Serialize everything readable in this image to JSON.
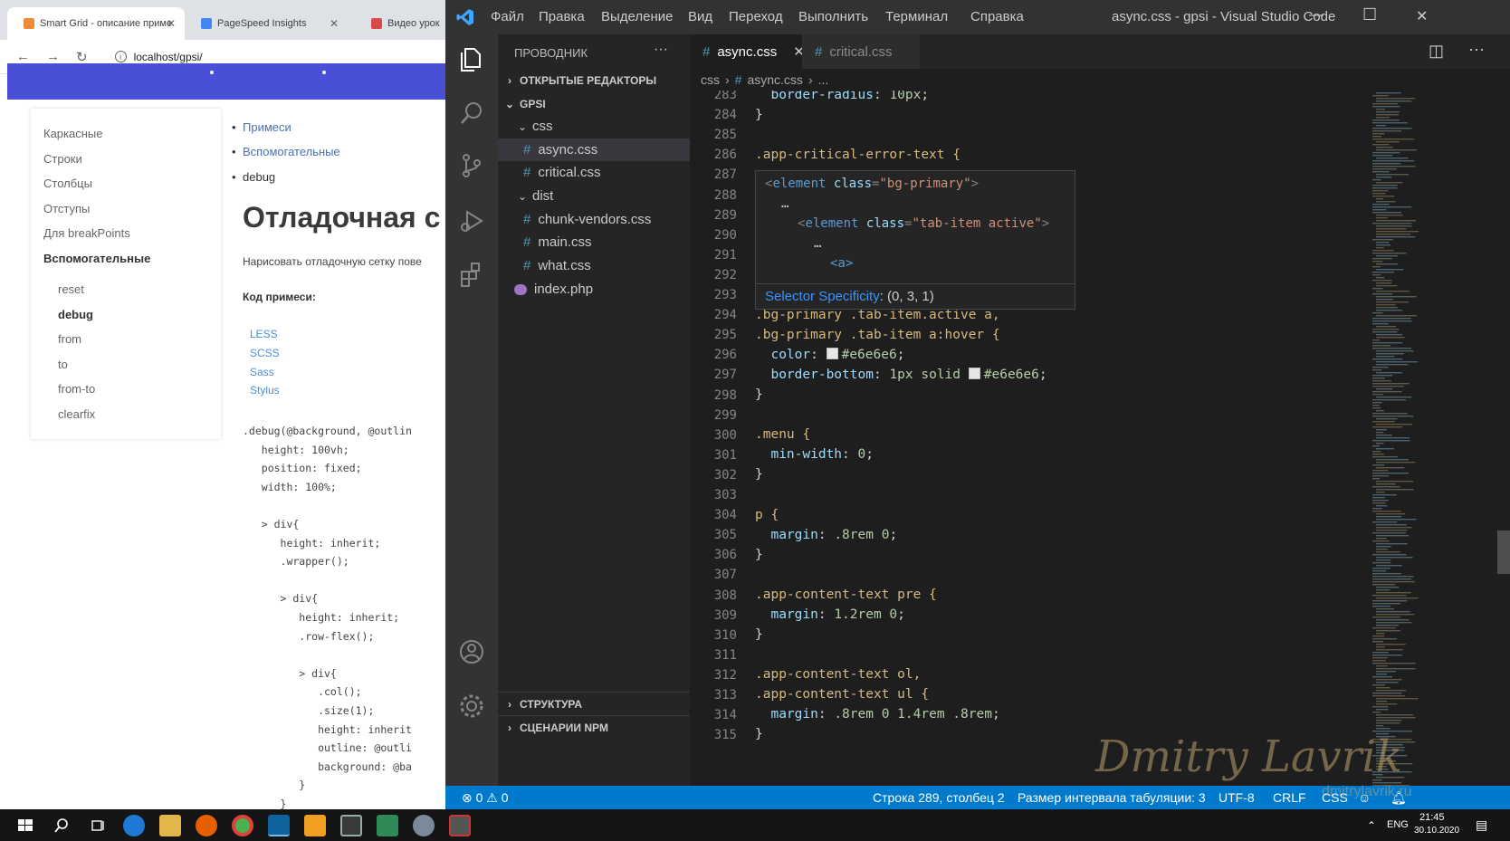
{
  "browser": {
    "tabs": [
      {
        "title": "Smart Grid - описание приме",
        "active": true
      },
      {
        "title": "PageSpeed Insights",
        "active": false
      },
      {
        "title": "Видео урок",
        "active": false
      }
    ],
    "url": "localhost/gpsi/",
    "sidebar": {
      "items": [
        "Каркасные",
        "Строки",
        "Столбцы",
        "Отступы",
        "Для breakPoints",
        "Вспомогательные"
      ],
      "subitems": [
        "reset",
        "debug",
        "from",
        "to",
        "from-to",
        "clearfix"
      ]
    },
    "content": {
      "bullets": [
        "Примеси",
        "Вспомогательные",
        "debug"
      ],
      "heading": "Отладочная с",
      "description": "Нарисовать отладочную сетку пове",
      "subheading": "Код примеси:",
      "langs": [
        "LESS",
        "SCSS",
        "Sass",
        "Stylus"
      ],
      "code": [
        ".debug(@background, @outlin",
        "   height: 100vh;",
        "   position: fixed;",
        "   width: 100%;",
        "",
        "   > div{",
        "      height: inherit;",
        "      .wrapper();",
        "",
        "      > div{",
        "         height: inherit;",
        "         .row-flex();",
        "",
        "         > div{",
        "            .col();",
        "            .size(1);",
        "            height: inherit",
        "            outline: @outli",
        "            background: @ba",
        "         }",
        "      }"
      ]
    }
  },
  "vscode": {
    "menu": [
      "Файл",
      "Правка",
      "Выделение",
      "Вид",
      "Переход",
      "Выполнить",
      "Терминал",
      "Справка"
    ],
    "window_title": "async.css - gpsi - Visual Studio Code",
    "explorer": {
      "header": "ПРОВОДНИК",
      "open_editors": "ОТКРЫТЫЕ РЕДАКТОРЫ",
      "root": "GPSI",
      "css_folder": "css",
      "css_files": [
        "async.css",
        "critical.css"
      ],
      "dist_folder": "dist",
      "dist_files": [
        "chunk-vendors.css",
        "main.css",
        "what.css"
      ],
      "root_file": "index.php",
      "structure": "СТРУКТУРА",
      "npm": "СЦЕНАРИИ NPM"
    },
    "tabs": [
      {
        "label": "async.css",
        "active": true
      },
      {
        "label": "critical.css",
        "active": false
      }
    ],
    "breadcrumb": [
      "css",
      "async.css",
      "..."
    ],
    "line_numbers": [
      "283",
      "284",
      "285",
      "286",
      "287",
      "288",
      "289",
      "290",
      "291",
      "292",
      "293",
      "294",
      "295",
      "296",
      "297",
      "298",
      "299",
      "300",
      "301",
      "302",
      "303",
      "304",
      "305",
      "306",
      "307",
      "308",
      "309",
      "310",
      "311",
      "312",
      "313",
      "314",
      "315"
    ],
    "code": {
      "l283_prop": "border-radius",
      "l283_val": "10px",
      "l284": "}",
      "l286": ".app-critical-error-text {",
      "l294": ".bg-primary .tab-item.active a,",
      "l295": ".bg-primary .tab-item a:hover {",
      "l296_prop": "color",
      "l296_val": "#e6e6e6",
      "l297_prop": "border-bottom",
      "l297_val": "1px solid",
      "l297_color": "#e6e6e6",
      "l298": "}",
      "l300": ".menu {",
      "l301_prop": "min-width",
      "l301_val": "0",
      "l302": "}",
      "l304": "p {",
      "l305_prop": "margin",
      "l305_val": ".8rem 0",
      "l306": "}",
      "l308": ".app-content-text pre {",
      "l309_prop": "margin",
      "l309_val": "1.2rem 0",
      "l310": "}",
      "l312": ".app-content-text ol,",
      "l313": ".app-content-text ul {",
      "l314_prop": "margin",
      "l314_val": ".8rem 0 1.4rem .8rem",
      "l315": "}"
    },
    "hover": {
      "line1_tag": "element",
      "line1_attr": "class",
      "line1_val": "\"bg-primary\"",
      "line2": "…",
      "line3_tag": "element",
      "line3_attr": "class",
      "line3_val": "\"tab-item active\"",
      "line4": "…",
      "line5": "<a>",
      "spec_label": "Selector Specificity",
      "spec_value": ": (0, 3, 1)"
    },
    "status": {
      "errors": "0",
      "warnings": "0",
      "position": "Строка 289, столбец 2",
      "indent": "Размер интервала табуляции: 3",
      "encoding": "UTF-8",
      "eol": "CRLF",
      "language": "CSS"
    },
    "watermark": "Dmitry Lavrik",
    "watermark_url": "dmitrylavrik.ru"
  },
  "taskbar": {
    "lang": "ENG",
    "time": "21:45",
    "date": "30.10.2020"
  }
}
